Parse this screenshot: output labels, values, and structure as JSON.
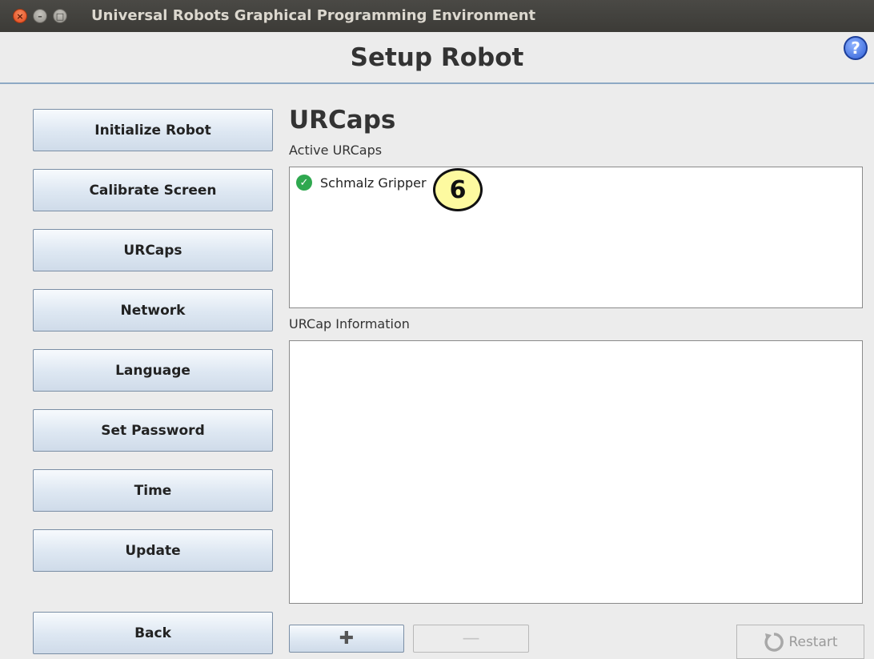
{
  "window": {
    "title": "Universal Robots Graphical Programming Environment",
    "close_glyph": "×",
    "min_glyph": "–",
    "max_glyph": "□"
  },
  "header": {
    "title": "Setup Robot",
    "help_glyph": "?"
  },
  "sidebar": {
    "items": [
      {
        "label": "Initialize Robot"
      },
      {
        "label": "Calibrate Screen"
      },
      {
        "label": "URCaps"
      },
      {
        "label": "Network"
      },
      {
        "label": "Language"
      },
      {
        "label": "Set Password"
      },
      {
        "label": "Time"
      },
      {
        "label": "Update"
      }
    ],
    "back_label": "Back"
  },
  "main": {
    "title": "URCaps",
    "active_label": "Active URCaps",
    "active_urcaps": [
      {
        "name": "Schmalz Gripper",
        "status_icon": "check-circle-icon",
        "status_color": "#2fa84f"
      }
    ],
    "info_label": "URCap Information",
    "info_text": "",
    "add_glyph": "✚",
    "remove_glyph": "—",
    "restart_label": "Restart"
  },
  "annotation": {
    "step_number": "6"
  },
  "colors": {
    "titlebar": "#3c3b37",
    "header_rule": "#8ea9c4",
    "button_border": "#7a8ea5",
    "badge_fill": "#fdfaa0"
  }
}
